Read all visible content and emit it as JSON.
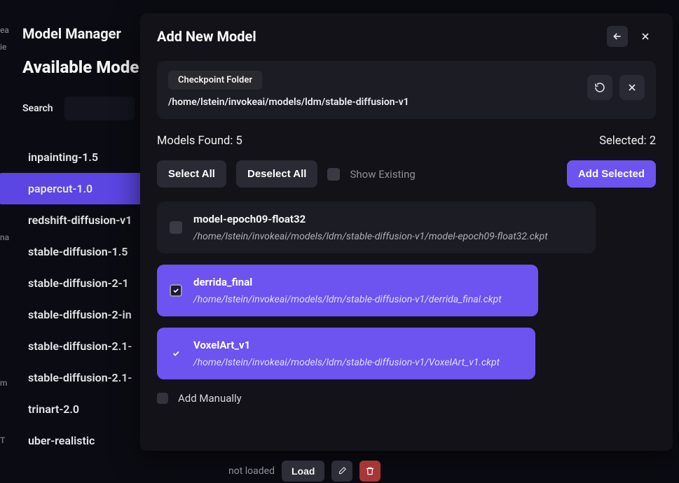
{
  "left": {
    "title": "Model Manager",
    "subtitle": "Available Mode",
    "search_label": "Search",
    "search_value": "",
    "items": [
      "inpainting-1.5",
      "papercut-1.0",
      "redshift-diffusion-v1",
      "stable-diffusion-1.5",
      "stable-diffusion-2-1",
      "stable-diffusion-2-in",
      "stable-diffusion-2.1-",
      "stable-diffusion-2.1-",
      "trinart-2.0",
      "uber-realistic"
    ]
  },
  "edge_fragments": {
    "f1": "ea",
    "f2": "ie",
    "f3": "na",
    "f4": "m",
    "f5": "T"
  },
  "modal": {
    "title": "Add New Model",
    "folder_badge": "Checkpoint Folder",
    "folder_path": "/home/lstein/invokeai/models/ldm/stable-diffusion-v1",
    "found_label": "Models Found: 5",
    "selected_label": "Selected: 2",
    "select_all": "Select All",
    "deselect_all": "Deselect All",
    "show_existing": "Show Existing",
    "add_selected": "Add Selected",
    "add_manually": "Add Manually",
    "items": [
      {
        "name": "model-epoch09-float32",
        "path": "/home/lstein/invokeai/models/ldm/stable-diffusion-v1/model-epoch09-float32.ckpt"
      },
      {
        "name": "derrida_final",
        "path": "/home/lstein/invokeai/models/ldm/stable-diffusion-v1/derrida_final.ckpt"
      },
      {
        "name": "VoxelArt_v1",
        "path": "/home/lstein/invokeai/models/ldm/stable-diffusion-v1/VoxelArt_v1.ckpt"
      }
    ]
  },
  "peek": {
    "status": "not loaded",
    "load": "Load"
  }
}
